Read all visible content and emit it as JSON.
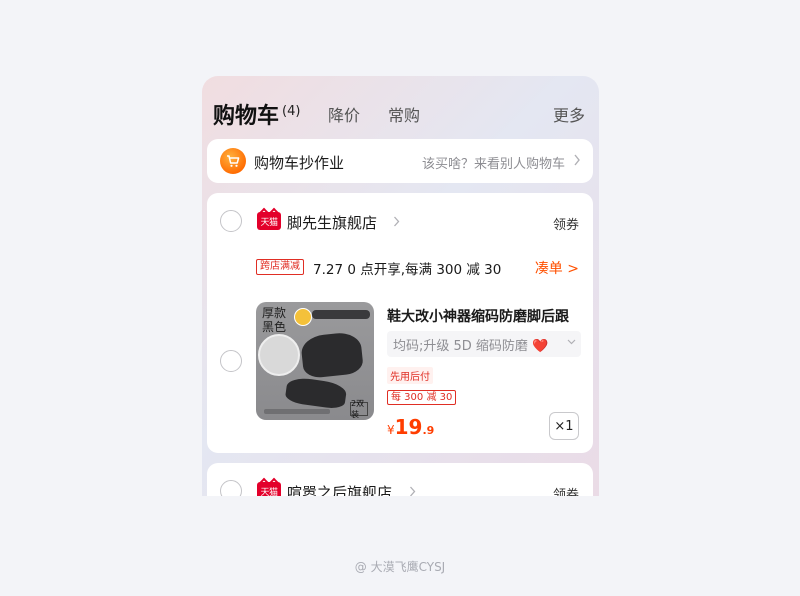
{
  "header": {
    "title": "购物车",
    "count": "(4)",
    "tabs": [
      "降价",
      "常购"
    ],
    "more": "更多"
  },
  "copy_homework": {
    "title": "购物车抄作业",
    "hint": "该买啥？来看别人购物车",
    "icon": "cart-icon"
  },
  "stores": [
    {
      "name": "脚先生旗舰店",
      "badge": "天猫",
      "coupon": "领券",
      "promo": {
        "tag": "跨店满减",
        "text": "7.27 0 点开享,每满 300 减 30",
        "action": "凑单 >"
      },
      "product": {
        "title": "鞋大改小神器缩码防磨脚后跟",
        "sku": "均码;升级 5D 缩码防磨",
        "sku_emoji": "❤️",
        "pay_later": "先用后付",
        "discount": "每 300 减 30",
        "price_symbol": "¥",
        "price_int": "19",
        "price_dec": ".9",
        "quantity": "×1",
        "image_text": "厚款黑色",
        "image_box": "2双装"
      }
    },
    {
      "name": "喧嚣之后旗舰店",
      "badge": "天猫",
      "coupon": "领券"
    }
  ],
  "watermark": "@ 大漠飞鹰CYSJ",
  "colors": {
    "accent": "#ff5000",
    "price": "#ff3d00",
    "tmall": "#e3002b"
  }
}
